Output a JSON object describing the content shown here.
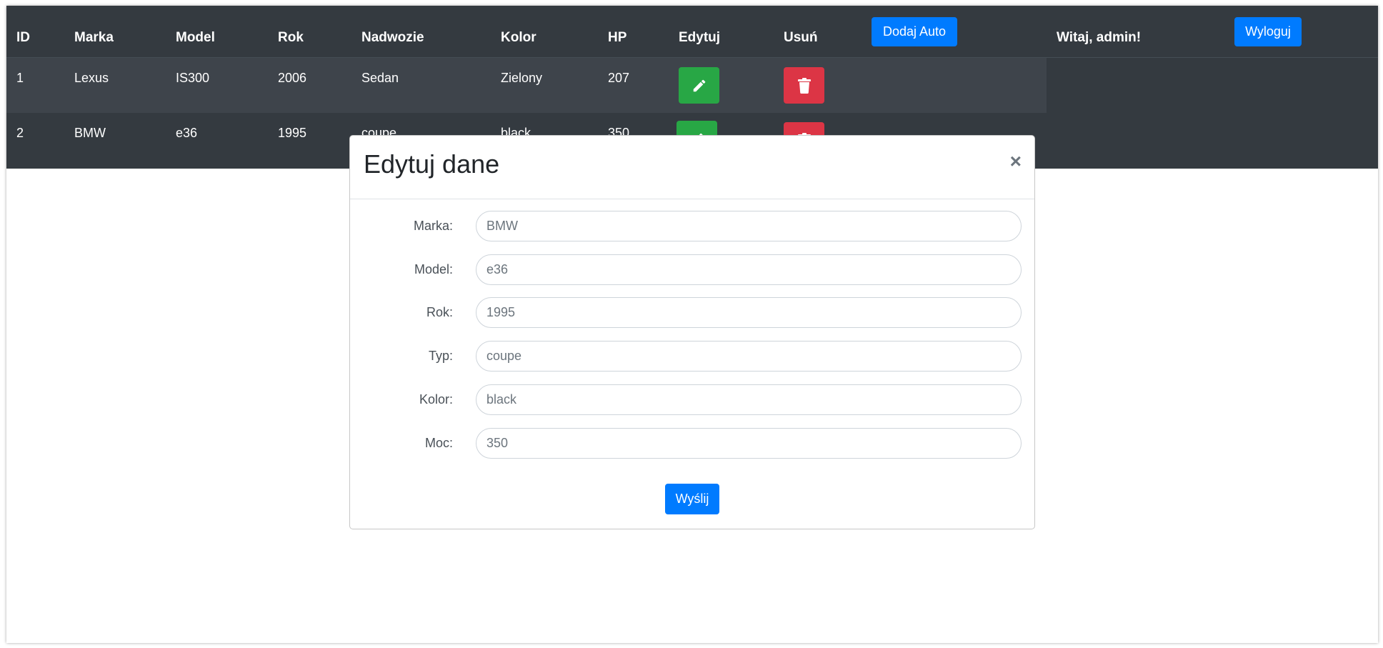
{
  "table": {
    "headers": [
      "ID",
      "Marka",
      "Model",
      "Rok",
      "Nadwozie",
      "Kolor",
      "HP",
      "Edytuj",
      "Usuń"
    ],
    "add_button": "Dodaj Auto",
    "welcome": "Witaj, admin!",
    "logout_button": "Wyloguj",
    "rows": [
      [
        "1",
        "Lexus",
        "IS300",
        "2006",
        "Sedan",
        "Zielony",
        "207"
      ],
      [
        "2",
        "BMW",
        "e36",
        "1995",
        "coupe",
        "black",
        "350"
      ]
    ]
  },
  "modal": {
    "title": "Edytuj dane",
    "close": "×",
    "fields": [
      {
        "label": "Marka:",
        "value": "BMW"
      },
      {
        "label": "Model:",
        "value": "e36"
      },
      {
        "label": "Rok:",
        "value": "1995"
      },
      {
        "label": "Typ:",
        "value": "coupe"
      },
      {
        "label": "Kolor:",
        "value": "black"
      },
      {
        "label": "Moc:",
        "value": "350"
      }
    ],
    "submit": "Wyślij"
  },
  "colors": {
    "dark": "#343a40",
    "primary": "#007bff",
    "success": "#28a745",
    "danger": "#dc3545"
  },
  "icons": {
    "edit": "pencil-icon",
    "delete": "trash-icon",
    "close": "close-icon"
  }
}
